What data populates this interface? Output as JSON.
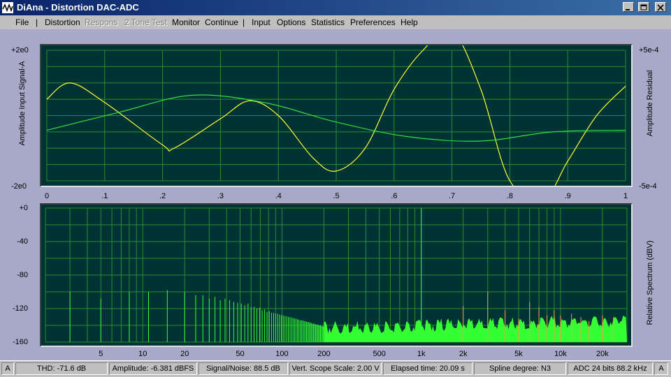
{
  "window": {
    "title": "DiAna - Distortion DAC-ADC"
  },
  "menu": {
    "items": [
      {
        "label": "File",
        "disabled": false
      },
      {
        "label": "Distortion",
        "disabled": false
      },
      {
        "label": "Respons",
        "disabled": true
      },
      {
        "label": "2 Tone Test",
        "disabled": true
      },
      {
        "label": "Monitor",
        "disabled": false
      },
      {
        "label": "Continue",
        "disabled": false
      },
      {
        "label": "Input",
        "disabled": false
      },
      {
        "label": "Options",
        "disabled": false
      },
      {
        "label": "Statistics",
        "disabled": false
      },
      {
        "label": "Preferences",
        "disabled": false
      },
      {
        "label": "Help",
        "disabled": false
      }
    ],
    "separator": "|"
  },
  "colors": {
    "plot_bg": "#003333",
    "grid": "#2e8b2e",
    "input_signal": "#ffff33",
    "residual": "#33dd44",
    "spectrum": "#33ff33",
    "harmonics": "#ff9944"
  },
  "scope": {
    "ylabel": "Amplitude Input Signal-A",
    "ylabel_right": "Amplitude Residual",
    "ymax_label": "+2e0",
    "ymin_label": "-2e0",
    "ymax_right_label": "+5e-4",
    "ymin_right_label": "-5e-4",
    "x_ticks": [
      "0",
      ".1",
      ".2",
      ".3",
      ".4",
      ".5",
      ".6",
      ".7",
      ".8",
      ".9",
      "1"
    ]
  },
  "spectrum": {
    "ylabel": "Relative Spectrum (dBV)",
    "y_ticks": [
      "+0",
      "-40",
      "-80",
      "-120",
      "-160"
    ],
    "x_ticks": [
      "5",
      "10",
      "20",
      "50",
      "100",
      "200",
      "500",
      "1k",
      "2k",
      "5k",
      "10k",
      "20k"
    ]
  },
  "chart_data": [
    {
      "type": "line",
      "ylim": [
        -2,
        2
      ],
      "xlim": [
        0,
        1
      ],
      "series": [
        {
          "x": [
            0,
            0.04,
            0.1,
            0.2,
            0.22,
            0.3,
            0.35,
            0.4,
            0.46,
            0.5,
            0.55,
            0.6,
            0.65,
            0.7,
            0.75,
            0.8,
            0.86,
            0.9,
            0.95,
            1.0
          ],
          "y": [
            0.5,
            1.0,
            0.4,
            -0.9,
            -1.0,
            -0.1,
            0.45,
            0.0,
            -1.3,
            -1.7,
            -1.0,
            0.8,
            2.0,
            2.6,
            0.8,
            -2.0,
            -2.5,
            -1.4,
            0.0,
            0.9
          ]
        },
        {
          "x": [
            0,
            0.125,
            0.25,
            0.375,
            0.5,
            0.625,
            0.75,
            0.875,
            1.0
          ],
          "y": [
            -0.45,
            0.1,
            0.62,
            0.4,
            -0.2,
            -0.65,
            -0.78,
            -0.5,
            -0.45
          ]
        }
      ]
    },
    {
      "type": "bar",
      "xscale": "log",
      "xlim": [
        2,
        30000
      ],
      "ylim": [
        -160,
        0
      ],
      "series": [
        {
          "x": [
            3,
            5,
            8,
            11,
            15,
            20,
            24,
            27,
            30,
            33,
            36,
            39,
            42,
            45,
            48,
            51,
            54,
            57,
            60,
            63,
            66,
            69,
            72,
            75,
            78,
            81,
            84,
            87,
            90,
            93,
            96,
            99,
            102,
            105,
            108,
            111,
            114,
            117,
            120,
            123,
            126,
            129,
            132,
            135,
            138,
            141,
            144,
            147,
            150,
            153,
            156,
            159,
            162,
            165,
            168,
            171,
            174,
            177,
            180,
            183,
            186,
            189,
            192,
            195,
            198
          ],
          "y": [
            -100,
            -108,
            -100,
            -100,
            -98,
            -100,
            -104,
            -104,
            -108,
            -106,
            -110,
            -108,
            -110,
            -112,
            -113,
            -114,
            -116,
            -114,
            -118,
            -118,
            -120,
            -119,
            -122,
            -121,
            -124,
            -123,
            -125,
            -125,
            -126,
            -126,
            -127,
            -128,
            -128,
            -129,
            -129,
            -130,
            -130,
            -131,
            -131,
            -132,
            -132,
            -133,
            -133,
            -134,
            -134,
            -134,
            -135,
            -135,
            -136,
            -136,
            -136,
            -137,
            -137,
            -138,
            -138,
            -138,
            -139,
            -139,
            -139,
            -140,
            -140,
            -140,
            -141,
            -141,
            -141
          ]
        },
        {
          "x": [
            1000,
            2000,
            3000,
            4000,
            5000,
            6000,
            7000,
            8000,
            9000,
            10000,
            12000,
            14000,
            16000,
            20000,
            24000
          ],
          "y": [
            0,
            -117,
            -100,
            -122,
            -132,
            -112,
            -118,
            -128,
            -122,
            -128,
            -126,
            -130,
            -135,
            -128,
            -130
          ]
        }
      ]
    }
  ],
  "status": [
    "A",
    "THD:  -71.6 dB",
    "Amplitude: -6.381 dBFS",
    "Signal/Noise:  88.5 dB",
    "Vert. Scope Scale: 2.00 V",
    "Elapsed time: 20.09 s",
    "Spline degree: N3",
    "ADC 24 bits 88.2 kHz",
    "A"
  ]
}
